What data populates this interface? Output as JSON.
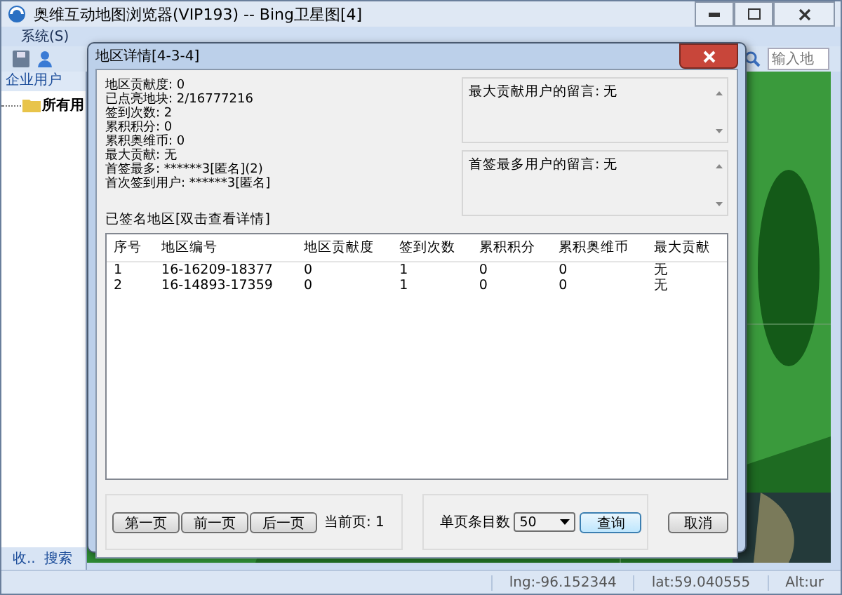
{
  "window": {
    "title": "奥维互动地图浏览器(VIP193) -- Bing卫星图[4]"
  },
  "menu": [
    {
      "label": "系统(S)"
    }
  ],
  "search": {
    "placeholder": "输入地"
  },
  "sidebar": {
    "title": "企业用户",
    "tree": [
      {
        "label": "所有用"
      }
    ],
    "tabs": [
      {
        "label": "收.."
      },
      {
        "label": "搜索"
      }
    ]
  },
  "status_bar": [
    "lng:-96.152344",
    "lat:59.040555",
    "Alt:ur"
  ],
  "dialog": {
    "title": "地区详情[4-3-4]",
    "info": [
      "地区贡献度: 0",
      "已点亮地块: 2/16777216",
      "签到次数: 2",
      "累积积分: 0",
      "累积奥维币: 0",
      "最大贡献: 无",
      "首签最多: ******3[匿名](2)",
      "首次签到用户: ******3[匿名]"
    ],
    "memos": [
      {
        "text": "最大贡献用户的留言: 无"
      },
      {
        "text": "首签最多用户的留言: 无"
      }
    ],
    "list_label": "已签名地区[双击查看详情]",
    "table": {
      "columns": [
        "序号",
        "地区编号",
        "地区贡献度",
        "签到次数",
        "累积积分",
        "累积奥维币",
        "最大贡献"
      ],
      "rows": [
        [
          "1",
          "16-16209-18377",
          "0",
          "1",
          "0",
          "0",
          "无"
        ],
        [
          "2",
          "16-14893-17359",
          "0",
          "1",
          "0",
          "0",
          "无"
        ]
      ]
    },
    "pager": {
      "buttons": [
        "第一页",
        "前一页",
        "后一页"
      ],
      "current": "当前页: 1"
    },
    "page_size": {
      "label": "单页条目数",
      "value": "50"
    },
    "buttons": [
      {
        "label": "查询",
        "focused": true
      },
      {
        "label": "取消",
        "focused": false
      }
    ]
  }
}
